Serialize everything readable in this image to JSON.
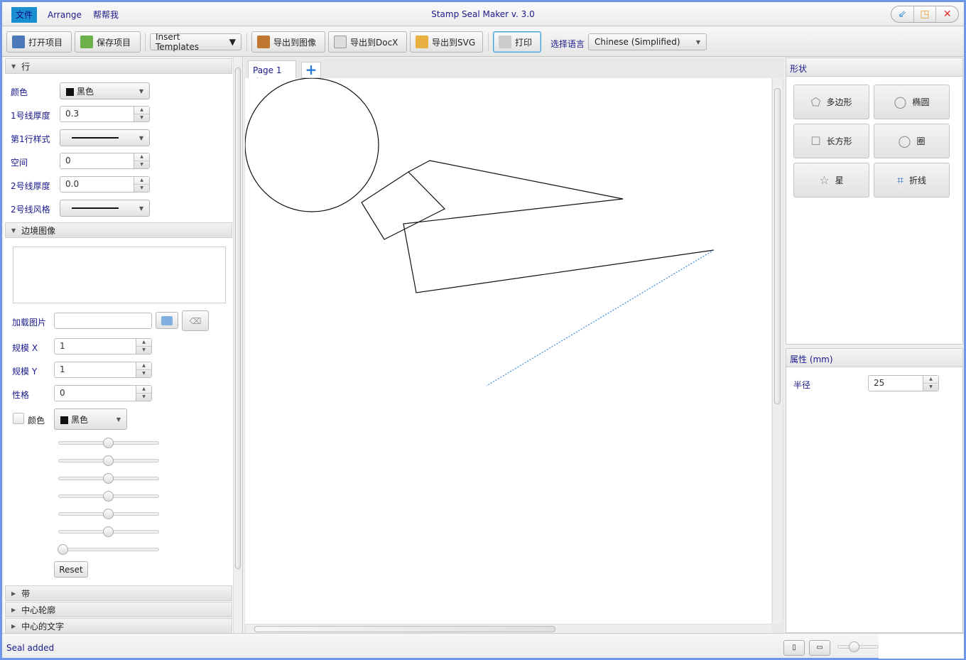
{
  "window": {
    "title": "Stamp Seal Maker v. 3.0",
    "controls": [
      "minimize",
      "maximize",
      "close"
    ]
  },
  "menu": {
    "items": [
      "文件",
      "Arrange",
      "帮帮我"
    ],
    "active": 0
  },
  "toolbar": {
    "open": "打开项目",
    "save": "保存项目",
    "templates": "Insert Templates",
    "export_image": "导出到图像",
    "export_docx": "导出到DocX",
    "export_svg": "导出到SVG",
    "print": "打印",
    "language_label": "选择语言",
    "language_value": "Chinese (Simplified)"
  },
  "left": {
    "line_section": {
      "title": "行",
      "color_label": "颜色",
      "color_value": "黑色",
      "thickness1_label": "1号线厚度",
      "thickness1": "0.3",
      "style1_label": "第1行样式",
      "spacing_label": "空间",
      "spacing": "0",
      "thickness2_label": "2号线厚度",
      "thickness2": "0.0",
      "style2_label": "2号线风格"
    },
    "border_image": {
      "title": "边境图像",
      "load_label": "加载图片",
      "load_value": "",
      "scale_x_label": "规模 X",
      "scale_x": "1",
      "scale_y_label": "规模 Y",
      "scale_y": "1",
      "nature_label": "性格",
      "nature": "0",
      "color_label": "颜色",
      "color_checked": false,
      "color_value": "黑色",
      "sliders": [
        0.5,
        0.5,
        0.5,
        0.5,
        0.5,
        0.5,
        0.0
      ],
      "reset": "Reset"
    },
    "collapsed": [
      "带",
      "中心轮廓",
      "中心的文字"
    ]
  },
  "tabs": {
    "items": [
      "Page 1"
    ],
    "add": "+"
  },
  "shapes": {
    "title": "形状",
    "buttons": [
      {
        "label": "多边形",
        "icon": "pentagon-icon"
      },
      {
        "label": "椭圆",
        "icon": "ellipse-icon"
      },
      {
        "label": "长方形",
        "icon": "rectangle-icon"
      },
      {
        "label": "圈",
        "icon": "circle-icon"
      },
      {
        "label": "星",
        "icon": "star-icon"
      },
      {
        "label": "折线",
        "icon": "polyline-icon"
      }
    ]
  },
  "properties": {
    "title": "属性 (mm)",
    "radius_label": "半径",
    "radius": "25"
  },
  "status": {
    "text": "Seal added",
    "zoom": 0.3
  }
}
